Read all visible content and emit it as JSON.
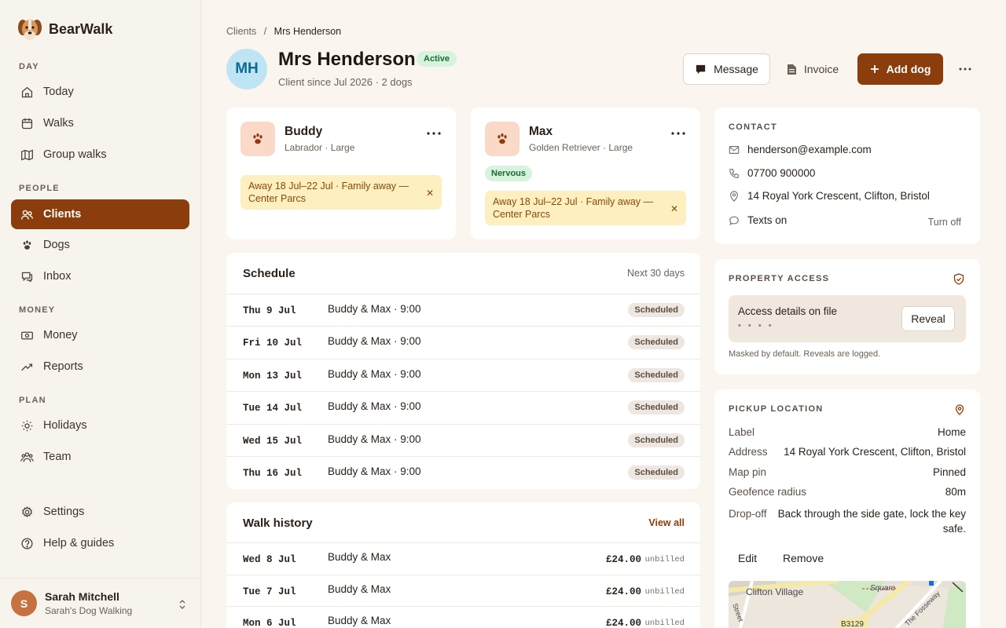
{
  "brand": {
    "name": "BearWalk"
  },
  "sidebar": {
    "sections": [
      "DAY",
      "PEOPLE",
      "MONEY",
      "PLAN"
    ],
    "items": [
      {
        "label": "Today",
        "icon": "home-icon"
      },
      {
        "label": "Walks",
        "icon": "calendar-icon"
      },
      {
        "label": "Group walks",
        "icon": "map-icon"
      },
      {
        "label": "Clients",
        "icon": "users-icon"
      },
      {
        "label": "Dogs",
        "icon": "paw-icon"
      },
      {
        "label": "Inbox",
        "icon": "chat-icon"
      },
      {
        "label": "Money",
        "icon": "money-icon"
      },
      {
        "label": "Reports",
        "icon": "trend-icon"
      },
      {
        "label": "Holidays",
        "icon": "sun-icon"
      },
      {
        "label": "Team",
        "icon": "team-icon"
      },
      {
        "label": "Settings",
        "icon": "gear-icon"
      },
      {
        "label": "Help & guides",
        "icon": "help-icon"
      }
    ],
    "active": "Clients",
    "user": {
      "initial": "S",
      "name": "Sarah Mitchell",
      "org": "Sarah's Dog Walking"
    }
  },
  "breadcrumb": {
    "parent": "Clients",
    "sep": "/",
    "current": "Mrs Henderson"
  },
  "client": {
    "initials": "MH",
    "name": "Mrs Henderson",
    "status": "Active",
    "since": "Client since Jul 2026 · 2 dogs"
  },
  "actions": {
    "message": "Message",
    "invoice": "Invoice",
    "add_dog": "Add dog"
  },
  "dogs": [
    {
      "name": "Buddy",
      "meta": "Labrador · Large",
      "tag": "",
      "away": "Away 18 Jul–22 Jul · Family away — Center Parcs"
    },
    {
      "name": "Max",
      "meta": "Golden Retriever · Large",
      "tag": "Nervous",
      "away": "Away 18 Jul–22 Jul · Family away — Center Parcs"
    }
  ],
  "schedule": {
    "title": "Schedule",
    "range": "Next 30 days",
    "rows": [
      {
        "date": "Thu 9 Jul",
        "desc": "Buddy & Max · 9:00",
        "status": "Scheduled"
      },
      {
        "date": "Fri 10 Jul",
        "desc": "Buddy & Max · 9:00",
        "status": "Scheduled"
      },
      {
        "date": "Mon 13 Jul",
        "desc": "Buddy & Max · 9:00",
        "status": "Scheduled"
      },
      {
        "date": "Tue 14 Jul",
        "desc": "Buddy & Max · 9:00",
        "status": "Scheduled"
      },
      {
        "date": "Wed 15 Jul",
        "desc": "Buddy & Max · 9:00",
        "status": "Scheduled"
      },
      {
        "date": "Thu 16 Jul",
        "desc": "Buddy & Max · 9:00",
        "status": "Scheduled"
      }
    ]
  },
  "history": {
    "title": "Walk history",
    "link": "View all",
    "rows": [
      {
        "date": "Wed 8 Jul",
        "desc": "Buddy & Max",
        "amount": "£24.00",
        "status": "unbilled"
      },
      {
        "date": "Tue 7 Jul",
        "desc": "Buddy & Max",
        "amount": "£24.00",
        "status": "unbilled"
      },
      {
        "date": "Mon 6 Jul",
        "desc": "Buddy & Max",
        "amount": "£24.00",
        "status": "unbilled"
      }
    ]
  },
  "contact": {
    "title": "CONTACT",
    "email": "henderson@example.com",
    "phone": "07700 900000",
    "address": "14 Royal York Crescent, Clifton, Bristol",
    "texts": "Texts on",
    "texts_action": "Turn off"
  },
  "access": {
    "title": "PROPERTY ACCESS",
    "text": "Access details on file",
    "masked": "• • • •",
    "reveal": "Reveal",
    "note": "Masked by default. Reveals are logged."
  },
  "pickup": {
    "title": "PICKUP LOCATION",
    "fields": [
      {
        "k": "Label",
        "v": "Home"
      },
      {
        "k": "Address",
        "v": "14 Royal York Crescent, Clifton, Bristol"
      },
      {
        "k": "Map pin",
        "v": "Pinned"
      },
      {
        "k": "Geofence radius",
        "v": "80m"
      },
      {
        "k": "Drop-off",
        "v": "Back through the side gate, lock the key safe."
      }
    ],
    "edit": "Edit",
    "remove": "Remove",
    "map_labels": [
      "Clifton Village",
      "Square",
      "B3129",
      "The Fosseway",
      "Street"
    ]
  },
  "colors": {
    "accent": "#8c3d0e",
    "bg": "#fbf5ef",
    "sidebar": "#f7f4ee"
  }
}
